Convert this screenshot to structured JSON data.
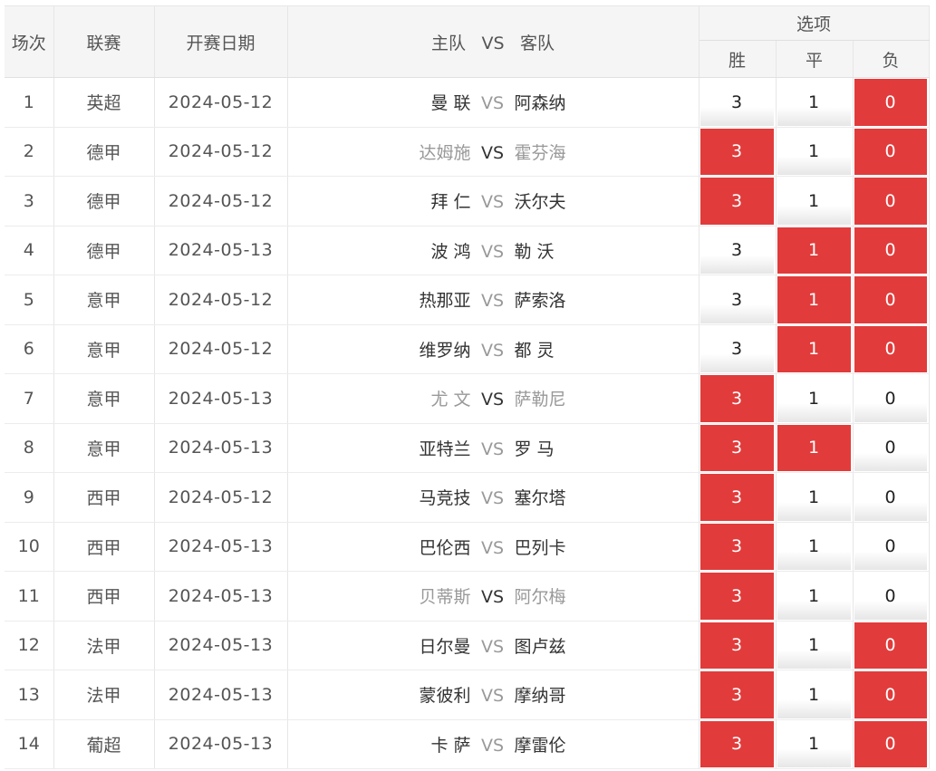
{
  "header": {
    "index": "场次",
    "league": "联赛",
    "date": "开赛日期",
    "home": "主队",
    "vs": "VS",
    "away": "客队",
    "options": "选项",
    "win": "胜",
    "draw": "平",
    "lose": "负"
  },
  "colors": {
    "selected": "#e23b3b",
    "header_bg": "#f5f5f5"
  },
  "rows": [
    {
      "no": "1",
      "league": "英超",
      "date": "2024-05-12",
      "home": "曼 联",
      "away": "阿森纳",
      "vs": "VS",
      "greyTeams": false,
      "darkVs": false,
      "opts": [
        {
          "v": "3",
          "on": false
        },
        {
          "v": "1",
          "on": false
        },
        {
          "v": "0",
          "on": true
        }
      ]
    },
    {
      "no": "2",
      "league": "德甲",
      "date": "2024-05-12",
      "home": "达姆施",
      "away": "霍芬海",
      "vs": "VS",
      "greyTeams": true,
      "darkVs": true,
      "opts": [
        {
          "v": "3",
          "on": true
        },
        {
          "v": "1",
          "on": false
        },
        {
          "v": "0",
          "on": true
        }
      ]
    },
    {
      "no": "3",
      "league": "德甲",
      "date": "2024-05-12",
      "home": "拜 仁",
      "away": "沃尔夫",
      "vs": "VS",
      "greyTeams": false,
      "darkVs": false,
      "opts": [
        {
          "v": "3",
          "on": true
        },
        {
          "v": "1",
          "on": false
        },
        {
          "v": "0",
          "on": true
        }
      ]
    },
    {
      "no": "4",
      "league": "德甲",
      "date": "2024-05-13",
      "home": "波 鸿",
      "away": "勒 沃",
      "vs": "VS",
      "greyTeams": false,
      "darkVs": false,
      "opts": [
        {
          "v": "3",
          "on": false
        },
        {
          "v": "1",
          "on": true
        },
        {
          "v": "0",
          "on": true
        }
      ]
    },
    {
      "no": "5",
      "league": "意甲",
      "date": "2024-05-12",
      "home": "热那亚",
      "away": "萨索洛",
      "vs": "VS",
      "greyTeams": false,
      "darkVs": false,
      "opts": [
        {
          "v": "3",
          "on": false
        },
        {
          "v": "1",
          "on": true
        },
        {
          "v": "0",
          "on": true
        }
      ]
    },
    {
      "no": "6",
      "league": "意甲",
      "date": "2024-05-12",
      "home": "维罗纳",
      "away": "都 灵",
      "vs": "VS",
      "greyTeams": false,
      "darkVs": false,
      "opts": [
        {
          "v": "3",
          "on": false
        },
        {
          "v": "1",
          "on": true
        },
        {
          "v": "0",
          "on": true
        }
      ]
    },
    {
      "no": "7",
      "league": "意甲",
      "date": "2024-05-13",
      "home": "尤 文",
      "away": "萨勒尼",
      "vs": "VS",
      "greyTeams": true,
      "darkVs": true,
      "opts": [
        {
          "v": "3",
          "on": true
        },
        {
          "v": "1",
          "on": false
        },
        {
          "v": "0",
          "on": false
        }
      ]
    },
    {
      "no": "8",
      "league": "意甲",
      "date": "2024-05-13",
      "home": "亚特兰",
      "away": "罗 马",
      "vs": "VS",
      "greyTeams": false,
      "darkVs": false,
      "opts": [
        {
          "v": "3",
          "on": true
        },
        {
          "v": "1",
          "on": true
        },
        {
          "v": "0",
          "on": false
        }
      ]
    },
    {
      "no": "9",
      "league": "西甲",
      "date": "2024-05-12",
      "home": "马竞技",
      "away": "塞尔塔",
      "vs": "VS",
      "greyTeams": false,
      "darkVs": false,
      "opts": [
        {
          "v": "3",
          "on": true
        },
        {
          "v": "1",
          "on": false
        },
        {
          "v": "0",
          "on": false
        }
      ]
    },
    {
      "no": "10",
      "league": "西甲",
      "date": "2024-05-13",
      "home": "巴伦西",
      "away": "巴列卡",
      "vs": "VS",
      "greyTeams": false,
      "darkVs": false,
      "opts": [
        {
          "v": "3",
          "on": true
        },
        {
          "v": "1",
          "on": false
        },
        {
          "v": "0",
          "on": false
        }
      ]
    },
    {
      "no": "11",
      "league": "西甲",
      "date": "2024-05-13",
      "home": "贝蒂斯",
      "away": "阿尔梅",
      "vs": "VS",
      "greyTeams": true,
      "darkVs": true,
      "opts": [
        {
          "v": "3",
          "on": true
        },
        {
          "v": "1",
          "on": false
        },
        {
          "v": "0",
          "on": false
        }
      ]
    },
    {
      "no": "12",
      "league": "法甲",
      "date": "2024-05-13",
      "home": "日尔曼",
      "away": "图卢兹",
      "vs": "VS",
      "greyTeams": false,
      "darkVs": false,
      "opts": [
        {
          "v": "3",
          "on": true
        },
        {
          "v": "1",
          "on": false
        },
        {
          "v": "0",
          "on": true
        }
      ]
    },
    {
      "no": "13",
      "league": "法甲",
      "date": "2024-05-13",
      "home": "蒙彼利",
      "away": "摩纳哥",
      "vs": "VS",
      "greyTeams": false,
      "darkVs": false,
      "opts": [
        {
          "v": "3",
          "on": true
        },
        {
          "v": "1",
          "on": false
        },
        {
          "v": "0",
          "on": true
        }
      ]
    },
    {
      "no": "14",
      "league": "葡超",
      "date": "2024-05-13",
      "home": "卡 萨",
      "away": "摩雷伦",
      "vs": "VS",
      "greyTeams": false,
      "darkVs": false,
      "opts": [
        {
          "v": "3",
          "on": true
        },
        {
          "v": "1",
          "on": false
        },
        {
          "v": "0",
          "on": true
        }
      ]
    }
  ]
}
